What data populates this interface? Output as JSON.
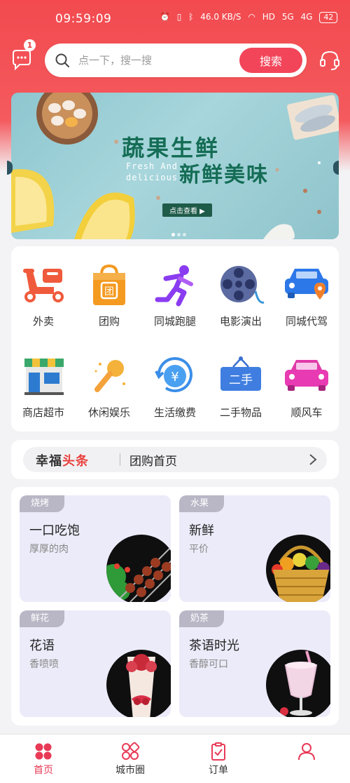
{
  "status_bar": {
    "time": "09:59:09",
    "net_speed": "46.0 KB/S",
    "hd": "HD",
    "sig1": "5G",
    "sig2": "4G",
    "battery": "42"
  },
  "header": {
    "message_badge": "1",
    "search_placeholder": "点一下，搜一搜",
    "search_button": "搜索"
  },
  "banner": {
    "title": "蔬果生鲜",
    "en_line1": "Fresh And",
    "en_line2": "delicious",
    "subtitle": "新鲜美味",
    "cta": "点击查看 ▶"
  },
  "grid": {
    "items": [
      {
        "label": "外卖",
        "icon": "scooter-icon"
      },
      {
        "label": "团购",
        "icon": "shopping-bag-icon"
      },
      {
        "label": "同城跑腿",
        "icon": "runner-icon"
      },
      {
        "label": "电影演出",
        "icon": "film-reel-icon"
      },
      {
        "label": "同城代驾",
        "icon": "car-location-icon"
      },
      {
        "label": "商店超市",
        "icon": "storefront-icon"
      },
      {
        "label": "休闲娱乐",
        "icon": "microphone-icon"
      },
      {
        "label": "生活缴费",
        "icon": "yen-refresh-icon"
      },
      {
        "label": "二手物品",
        "icon": "secondhand-sign-icon"
      },
      {
        "label": "顺风车",
        "icon": "pink-car-icon"
      }
    ]
  },
  "headline": {
    "logo_a": "幸福",
    "logo_b": "头条",
    "text": "团购首页"
  },
  "promos": [
    {
      "tag": "烧烤",
      "title": "一口吃饱",
      "subtitle": "厚厚的肉"
    },
    {
      "tag": "水果",
      "title": "新鲜",
      "subtitle": "平价"
    },
    {
      "tag": "鲜花",
      "title": "花语",
      "subtitle": "香喷喷"
    },
    {
      "tag": "奶茶",
      "title": "茶语时光",
      "subtitle": "香醇可口"
    }
  ],
  "tabbar": {
    "tabs": [
      {
        "label": "首页",
        "active": true
      },
      {
        "label": "城市圈",
        "active": false
      },
      {
        "label": "订单",
        "active": false
      }
    ]
  },
  "colors": {
    "brand_red": "#f2455a",
    "active_tab": "#e83a56",
    "promo_bg": "#ecebf9"
  }
}
